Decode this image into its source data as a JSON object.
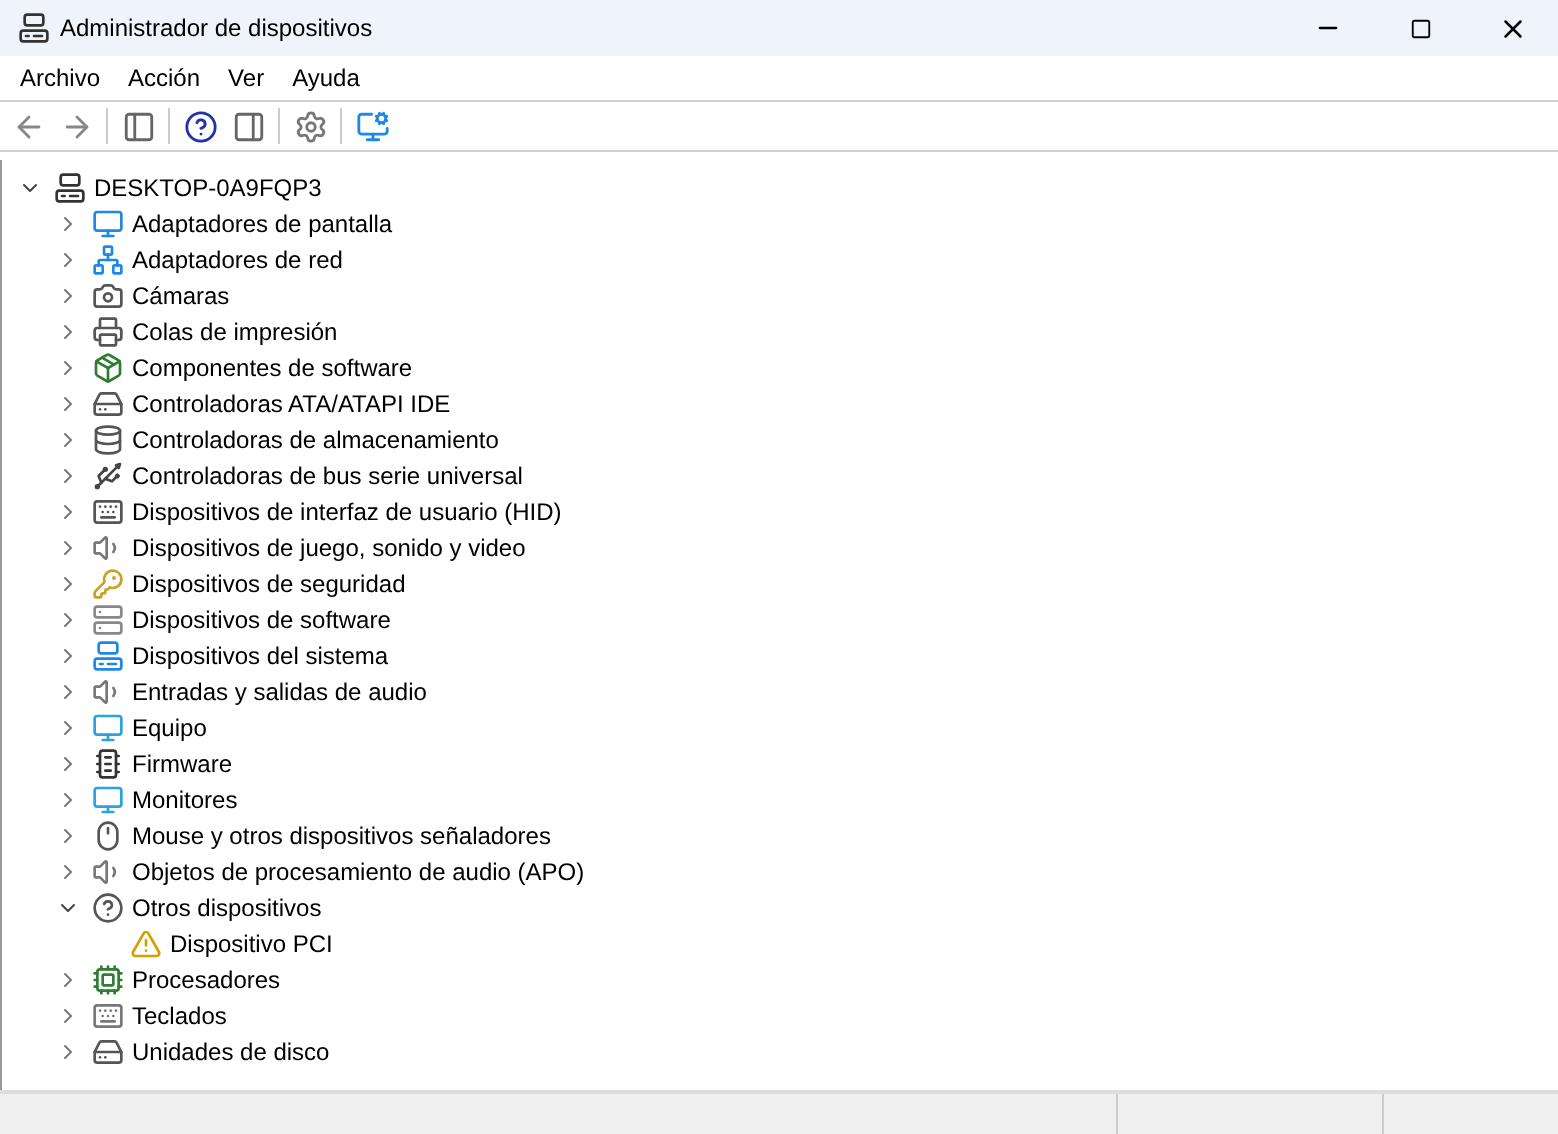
{
  "window": {
    "title": "Administrador de dispositivos"
  },
  "menu": [
    "Archivo",
    "Acción",
    "Ver",
    "Ayuda"
  ],
  "tree": {
    "label": "DESKTOP-0A9FQP3",
    "expanded": true,
    "children": [
      {
        "label": "Adaptadores de pantalla",
        "expanded": false
      },
      {
        "label": "Adaptadores de red",
        "expanded": false
      },
      {
        "label": "Cámaras",
        "expanded": false
      },
      {
        "label": "Colas de impresión",
        "expanded": false
      },
      {
        "label": "Componentes de software",
        "expanded": false
      },
      {
        "label": "Controladoras ATA/ATAPI IDE",
        "expanded": false
      },
      {
        "label": "Controladoras de almacenamiento",
        "expanded": false
      },
      {
        "label": "Controladoras de bus serie universal",
        "expanded": false
      },
      {
        "label": "Dispositivos de interfaz de usuario (HID)",
        "expanded": false
      },
      {
        "label": "Dispositivos de juego, sonido y video",
        "expanded": false
      },
      {
        "label": "Dispositivos de seguridad",
        "expanded": false
      },
      {
        "label": "Dispositivos de software",
        "expanded": false
      },
      {
        "label": "Dispositivos del sistema",
        "expanded": false
      },
      {
        "label": "Entradas y salidas de audio",
        "expanded": false
      },
      {
        "label": "Equipo",
        "expanded": false
      },
      {
        "label": "Firmware",
        "expanded": false
      },
      {
        "label": "Monitores",
        "expanded": false
      },
      {
        "label": "Mouse y otros dispositivos señaladores",
        "expanded": false
      },
      {
        "label": "Objetos de procesamiento de audio (APO)",
        "expanded": false
      },
      {
        "label": "Otros dispositivos",
        "expanded": true,
        "children": [
          {
            "label": "Dispositivo PCI",
            "warning": true
          }
        ]
      },
      {
        "label": "Procesadores",
        "expanded": false
      },
      {
        "label": "Teclados",
        "expanded": false
      },
      {
        "label": "Unidades de disco",
        "expanded": false
      }
    ]
  }
}
